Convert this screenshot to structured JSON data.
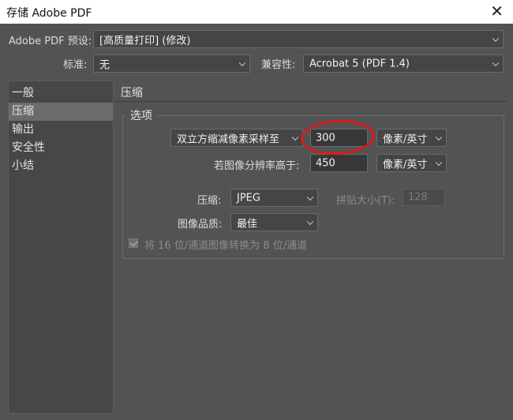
{
  "window": {
    "title": "存储 Adobe PDF"
  },
  "top": {
    "preset_label": "Adobe PDF 预设:",
    "preset_value": "[高质量打印] (修改)",
    "standard_label": "标准:",
    "standard_value": "无",
    "compat_label": "兼容性:",
    "compat_value": "Acrobat 5 (PDF 1.4)"
  },
  "sidebar": {
    "items": [
      {
        "label": "一般"
      },
      {
        "label": "压缩"
      },
      {
        "label": "输出"
      },
      {
        "label": "安全性"
      },
      {
        "label": "小结"
      }
    ],
    "selected": "压缩"
  },
  "panel": {
    "title": "压缩",
    "group_label": "选项",
    "downsample_method": "双立方缩减像素采样至",
    "downsample_value": "300",
    "downsample_unit": "像素/英寸",
    "threshold_label": "若图像分辨率高于:",
    "threshold_value": "450",
    "threshold_unit": "像素/英寸",
    "compression_label": "压缩:",
    "compression_value": "JPEG",
    "tile_label": "拼贴大小(T):",
    "tile_value": "128",
    "quality_label": "图像品质:",
    "quality_value": "最佳",
    "convert_label": "将 16 位/通道图像转换为 8 位/通道",
    "convert_checked": true
  },
  "annotation": {
    "color": "#e01818"
  }
}
